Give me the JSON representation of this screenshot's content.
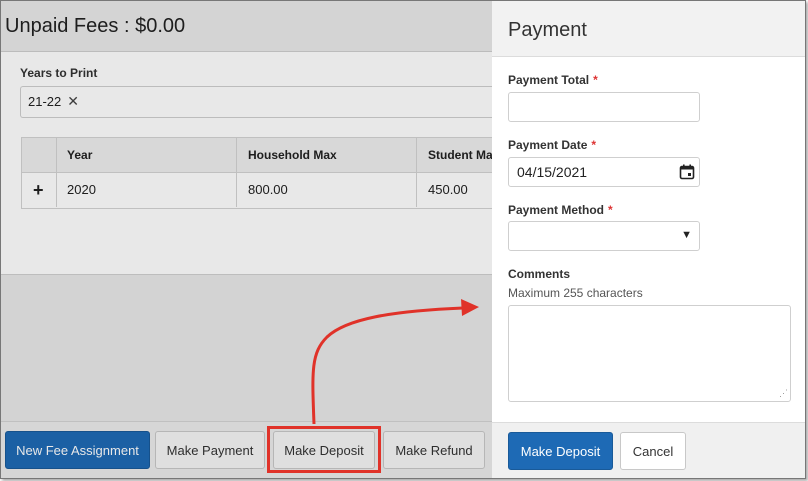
{
  "background_page": {
    "title": "Unpaid Fees : $0.00",
    "years_to_print": {
      "label": "Years to Print",
      "selected_chip": "21-22"
    },
    "grid": {
      "headers": [
        "Year",
        "Household Max",
        "Student Max"
      ],
      "rows": [
        {
          "expand": "+",
          "year": "2020",
          "household_max": "800.00",
          "student_max": "450.00"
        }
      ]
    },
    "toolbar": {
      "new_fee_assignment": "New Fee Assignment",
      "make_payment": "Make Payment",
      "make_deposit": "Make Deposit",
      "make_refund": "Make Refund"
    }
  },
  "payment_panel": {
    "title": "Payment",
    "payment_total": {
      "label": "Payment Total",
      "value": ""
    },
    "payment_date": {
      "label": "Payment Date",
      "value": "04/15/2021"
    },
    "payment_method": {
      "label": "Payment Method",
      "value": ""
    },
    "comments": {
      "label": "Comments",
      "hint": "Maximum 255 characters",
      "value": ""
    },
    "required_marker": "*",
    "footer": {
      "submit": "Make Deposit",
      "cancel": "Cancel"
    }
  },
  "icons": {
    "remove_chip": "close-icon",
    "date_picker": "calendar-icon",
    "dropdown": "caret-down-icon",
    "expand_row": "plus-icon"
  },
  "colors": {
    "primary": "#1e6ab5",
    "annotation": "#e03229",
    "required": "#dd3333"
  }
}
